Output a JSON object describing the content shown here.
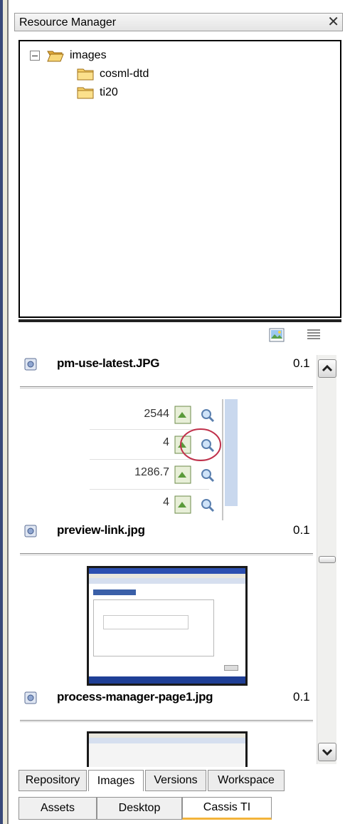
{
  "window": {
    "title": "Resource Manager",
    "close_glyph": "✕"
  },
  "tree": {
    "root": {
      "label": "images",
      "expanded": true
    },
    "children": [
      {
        "label": "cosml-dtd"
      },
      {
        "label": "ti20"
      }
    ]
  },
  "toolbar": {
    "icons": [
      "image-view-icon",
      "list-view-icon"
    ]
  },
  "files": [
    {
      "name": "pm-use-latest.JPG",
      "version": "0.1"
    },
    {
      "name": "preview-link.jpg",
      "version": "0.1",
      "preview_numbers": [
        "2544",
        "4",
        "1286.7",
        "4"
      ]
    },
    {
      "name": "process-manager-page1.jpg",
      "version": "0.1"
    }
  ],
  "tabs_top": [
    {
      "label": "Repository",
      "active": false
    },
    {
      "label": "Images",
      "active": true
    },
    {
      "label": "Versions",
      "active": false
    },
    {
      "label": "Workspace",
      "active": false
    }
  ],
  "tabs_bottom": [
    {
      "label": "Assets",
      "active": false
    },
    {
      "label": "Desktop",
      "active": false
    },
    {
      "label": "Cassis TI",
      "active": true
    }
  ],
  "colors": {
    "folder": "#f2c75a",
    "accent": "#f3b43a"
  }
}
